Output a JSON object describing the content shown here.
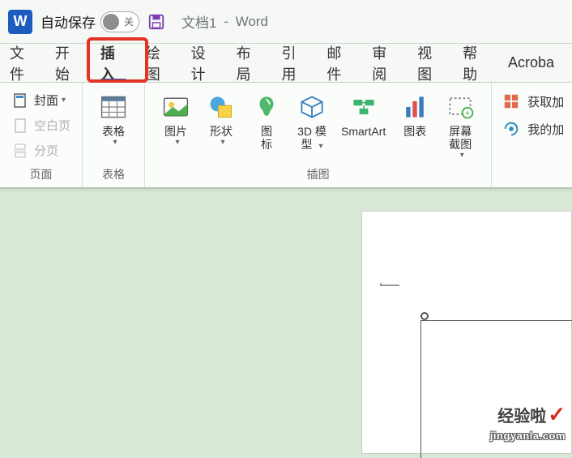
{
  "title": {
    "autosave_label": "自动保存",
    "autosave_state": "关",
    "doc_name": "文档1",
    "doc_sep": "-",
    "app_name": "Word"
  },
  "tabs": {
    "file": "文件",
    "home": "开始",
    "insert": "插入",
    "draw": "绘图",
    "design": "设计",
    "layout": "布局",
    "references": "引用",
    "mailings": "邮件",
    "review": "审阅",
    "view": "视图",
    "help": "帮助",
    "acrobat": "Acroba"
  },
  "ribbon": {
    "pages": {
      "cover": "封面",
      "blank": "空白页",
      "break": "分页",
      "group": "页面"
    },
    "table": {
      "label": "表格",
      "group": "表格"
    },
    "illustrations": {
      "picture": "图片",
      "shapes": "形状",
      "icons_l1": "图",
      "icons_l2": "标",
      "model_l1": "3D 模",
      "model_l2": "型",
      "smartart": "SmartArt",
      "chart": "图表",
      "screenshot": "屏幕截图",
      "group": "插图"
    },
    "addins": {
      "get": "获取加",
      "my": "我的加"
    }
  },
  "watermark": {
    "brand": "经验啦",
    "url": "jingyanla.com"
  }
}
